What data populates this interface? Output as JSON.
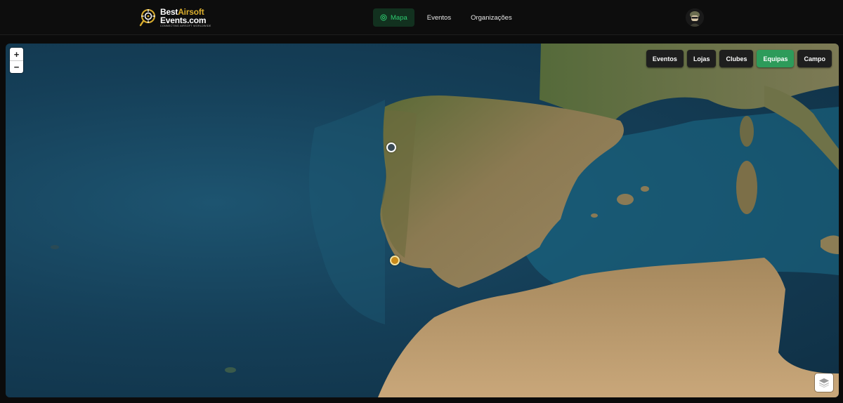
{
  "header": {
    "logo": {
      "line1_a": "Best",
      "line1_b": "Airsoft",
      "line2": "Events.com",
      "tagline": "CONNECTING AIRSOFT WORLDWIDE"
    },
    "nav": [
      {
        "label": "Mapa",
        "active": true,
        "icon": "map-pin-icon"
      },
      {
        "label": "Eventos",
        "active": false
      },
      {
        "label": "Organizações",
        "active": false
      }
    ]
  },
  "map": {
    "zoom_in": "+",
    "zoom_out": "−",
    "filters": [
      {
        "label": "Eventos",
        "active": false
      },
      {
        "label": "Lojas",
        "active": false
      },
      {
        "label": "Clubes",
        "active": false
      },
      {
        "label": "Equipas",
        "active": true
      },
      {
        "label": "Campo",
        "active": false
      }
    ],
    "layer_control_icon": "layers-icon"
  },
  "colors": {
    "accent_green": "#2d9b5a",
    "nav_active_text": "#2ecc71",
    "logo_gold": "#d9ad2e"
  }
}
